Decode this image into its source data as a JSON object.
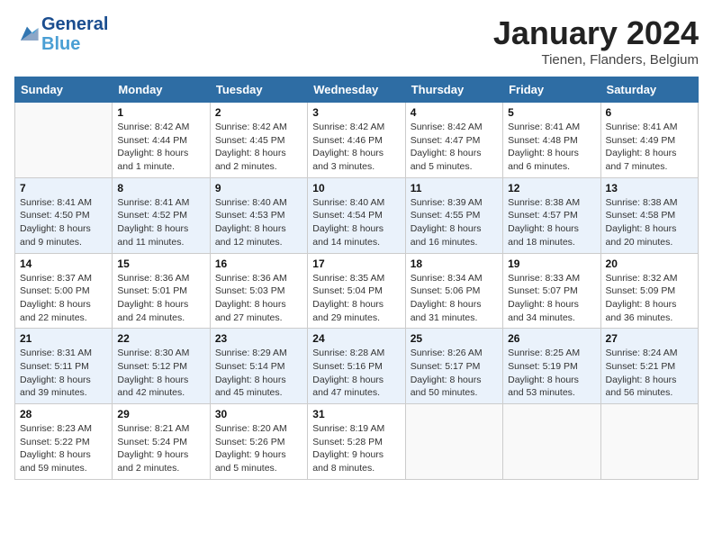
{
  "header": {
    "logo_line1": "General",
    "logo_line2": "Blue",
    "month_title": "January 2024",
    "location": "Tienen, Flanders, Belgium"
  },
  "days_of_week": [
    "Sunday",
    "Monday",
    "Tuesday",
    "Wednesday",
    "Thursday",
    "Friday",
    "Saturday"
  ],
  "weeks": [
    [
      {
        "day": "",
        "sunrise": "",
        "sunset": "",
        "daylight": ""
      },
      {
        "day": "1",
        "sunrise": "Sunrise: 8:42 AM",
        "sunset": "Sunset: 4:44 PM",
        "daylight": "Daylight: 8 hours and 1 minute."
      },
      {
        "day": "2",
        "sunrise": "Sunrise: 8:42 AM",
        "sunset": "Sunset: 4:45 PM",
        "daylight": "Daylight: 8 hours and 2 minutes."
      },
      {
        "day": "3",
        "sunrise": "Sunrise: 8:42 AM",
        "sunset": "Sunset: 4:46 PM",
        "daylight": "Daylight: 8 hours and 3 minutes."
      },
      {
        "day": "4",
        "sunrise": "Sunrise: 8:42 AM",
        "sunset": "Sunset: 4:47 PM",
        "daylight": "Daylight: 8 hours and 5 minutes."
      },
      {
        "day": "5",
        "sunrise": "Sunrise: 8:41 AM",
        "sunset": "Sunset: 4:48 PM",
        "daylight": "Daylight: 8 hours and 6 minutes."
      },
      {
        "day": "6",
        "sunrise": "Sunrise: 8:41 AM",
        "sunset": "Sunset: 4:49 PM",
        "daylight": "Daylight: 8 hours and 7 minutes."
      }
    ],
    [
      {
        "day": "7",
        "sunrise": "Sunrise: 8:41 AM",
        "sunset": "Sunset: 4:50 PM",
        "daylight": "Daylight: 8 hours and 9 minutes."
      },
      {
        "day": "8",
        "sunrise": "Sunrise: 8:41 AM",
        "sunset": "Sunset: 4:52 PM",
        "daylight": "Daylight: 8 hours and 11 minutes."
      },
      {
        "day": "9",
        "sunrise": "Sunrise: 8:40 AM",
        "sunset": "Sunset: 4:53 PM",
        "daylight": "Daylight: 8 hours and 12 minutes."
      },
      {
        "day": "10",
        "sunrise": "Sunrise: 8:40 AM",
        "sunset": "Sunset: 4:54 PM",
        "daylight": "Daylight: 8 hours and 14 minutes."
      },
      {
        "day": "11",
        "sunrise": "Sunrise: 8:39 AM",
        "sunset": "Sunset: 4:55 PM",
        "daylight": "Daylight: 8 hours and 16 minutes."
      },
      {
        "day": "12",
        "sunrise": "Sunrise: 8:38 AM",
        "sunset": "Sunset: 4:57 PM",
        "daylight": "Daylight: 8 hours and 18 minutes."
      },
      {
        "day": "13",
        "sunrise": "Sunrise: 8:38 AM",
        "sunset": "Sunset: 4:58 PM",
        "daylight": "Daylight: 8 hours and 20 minutes."
      }
    ],
    [
      {
        "day": "14",
        "sunrise": "Sunrise: 8:37 AM",
        "sunset": "Sunset: 5:00 PM",
        "daylight": "Daylight: 8 hours and 22 minutes."
      },
      {
        "day": "15",
        "sunrise": "Sunrise: 8:36 AM",
        "sunset": "Sunset: 5:01 PM",
        "daylight": "Daylight: 8 hours and 24 minutes."
      },
      {
        "day": "16",
        "sunrise": "Sunrise: 8:36 AM",
        "sunset": "Sunset: 5:03 PM",
        "daylight": "Daylight: 8 hours and 27 minutes."
      },
      {
        "day": "17",
        "sunrise": "Sunrise: 8:35 AM",
        "sunset": "Sunset: 5:04 PM",
        "daylight": "Daylight: 8 hours and 29 minutes."
      },
      {
        "day": "18",
        "sunrise": "Sunrise: 8:34 AM",
        "sunset": "Sunset: 5:06 PM",
        "daylight": "Daylight: 8 hours and 31 minutes."
      },
      {
        "day": "19",
        "sunrise": "Sunrise: 8:33 AM",
        "sunset": "Sunset: 5:07 PM",
        "daylight": "Daylight: 8 hours and 34 minutes."
      },
      {
        "day": "20",
        "sunrise": "Sunrise: 8:32 AM",
        "sunset": "Sunset: 5:09 PM",
        "daylight": "Daylight: 8 hours and 36 minutes."
      }
    ],
    [
      {
        "day": "21",
        "sunrise": "Sunrise: 8:31 AM",
        "sunset": "Sunset: 5:11 PM",
        "daylight": "Daylight: 8 hours and 39 minutes."
      },
      {
        "day": "22",
        "sunrise": "Sunrise: 8:30 AM",
        "sunset": "Sunset: 5:12 PM",
        "daylight": "Daylight: 8 hours and 42 minutes."
      },
      {
        "day": "23",
        "sunrise": "Sunrise: 8:29 AM",
        "sunset": "Sunset: 5:14 PM",
        "daylight": "Daylight: 8 hours and 45 minutes."
      },
      {
        "day": "24",
        "sunrise": "Sunrise: 8:28 AM",
        "sunset": "Sunset: 5:16 PM",
        "daylight": "Daylight: 8 hours and 47 minutes."
      },
      {
        "day": "25",
        "sunrise": "Sunrise: 8:26 AM",
        "sunset": "Sunset: 5:17 PM",
        "daylight": "Daylight: 8 hours and 50 minutes."
      },
      {
        "day": "26",
        "sunrise": "Sunrise: 8:25 AM",
        "sunset": "Sunset: 5:19 PM",
        "daylight": "Daylight: 8 hours and 53 minutes."
      },
      {
        "day": "27",
        "sunrise": "Sunrise: 8:24 AM",
        "sunset": "Sunset: 5:21 PM",
        "daylight": "Daylight: 8 hours and 56 minutes."
      }
    ],
    [
      {
        "day": "28",
        "sunrise": "Sunrise: 8:23 AM",
        "sunset": "Sunset: 5:22 PM",
        "daylight": "Daylight: 8 hours and 59 minutes."
      },
      {
        "day": "29",
        "sunrise": "Sunrise: 8:21 AM",
        "sunset": "Sunset: 5:24 PM",
        "daylight": "Daylight: 9 hours and 2 minutes."
      },
      {
        "day": "30",
        "sunrise": "Sunrise: 8:20 AM",
        "sunset": "Sunset: 5:26 PM",
        "daylight": "Daylight: 9 hours and 5 minutes."
      },
      {
        "day": "31",
        "sunrise": "Sunrise: 8:19 AM",
        "sunset": "Sunset: 5:28 PM",
        "daylight": "Daylight: 9 hours and 8 minutes."
      },
      {
        "day": "",
        "sunrise": "",
        "sunset": "",
        "daylight": ""
      },
      {
        "day": "",
        "sunrise": "",
        "sunset": "",
        "daylight": ""
      },
      {
        "day": "",
        "sunrise": "",
        "sunset": "",
        "daylight": ""
      }
    ]
  ]
}
